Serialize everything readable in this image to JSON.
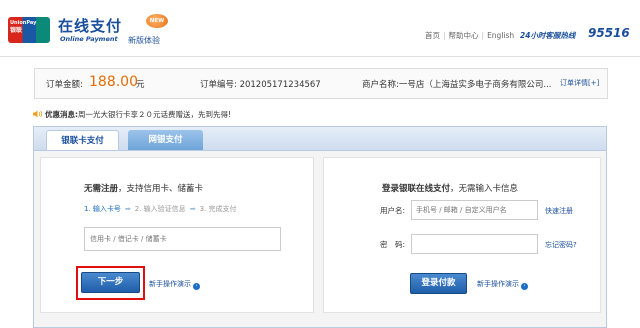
{
  "header": {
    "card_logo_line1": "UnionPay",
    "card_logo_line2": "银联",
    "logo_title": "在线支付",
    "logo_subtitle": "Online Payment",
    "new_badge": "NEW",
    "new_version": "新版体验",
    "links": [
      "首页",
      "帮助中心",
      "English"
    ],
    "hotline_label": "24小时客服热线",
    "hotline_number": "95516"
  },
  "order": {
    "amount_label": "订单金额:",
    "amount_value": "188.00",
    "amount_unit": "元",
    "order_no_label": "订单编号:",
    "order_no_value": "201205171234567",
    "merchant_label": "商户名称:",
    "merchant_value": "一号店（上海益实多电子商务有限公司...",
    "detail_link": "订单详情[+]"
  },
  "promo": {
    "label": "优惠消息:",
    "text": "周一光大银行卡享２０元话费赠送，先到先得!"
  },
  "tabs": [
    {
      "label": "银联卡支付",
      "active": true
    },
    {
      "label": "网银支付",
      "active": false
    }
  ],
  "left_card": {
    "title_bold": "无需注册",
    "title_rest": "，支持信用卡、储蓄卡",
    "steps": [
      "1. 输入卡号",
      "2. 输入验证信息",
      "3. 完成支付"
    ],
    "card_placeholder": "信用卡 / 借记卡 / 储蓄卡",
    "next_button": "下一步",
    "demo_link": "新手操作演示"
  },
  "right_card": {
    "title_bold": "登录银联在线支付",
    "title_rest": "，无需输入卡信息",
    "username_label": "用户名:",
    "username_placeholder": "手机号 / 邮箱 / 自定义用户名",
    "register_link": "快速注册",
    "password_label": "密　码:",
    "forgot_link": "忘记密码?",
    "login_button": "登录付款",
    "demo_link": "新手操作演示"
  },
  "colors": {
    "brand_blue": "#1a4f9c",
    "amount_orange": "#e36c09",
    "highlight_red": "#e01010"
  }
}
